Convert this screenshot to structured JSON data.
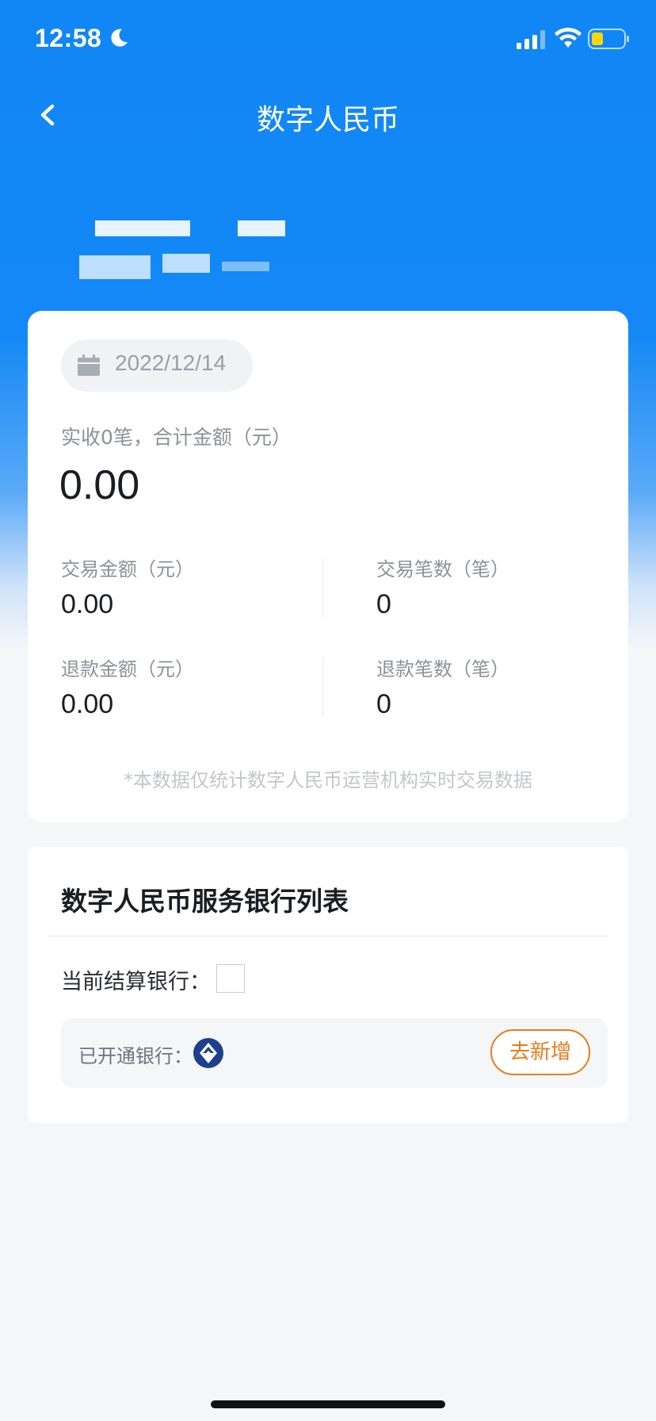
{
  "status_bar": {
    "time": "12:58",
    "icons": [
      "moon-icon",
      "signal-icon",
      "wifi-icon",
      "battery-icon"
    ]
  },
  "nav": {
    "title": "数字人民币",
    "back_icon": "chevron-left-icon"
  },
  "summary_card": {
    "date": "2022/12/14",
    "summary_label": "实收0笔，合计金额（元）",
    "summary_amount": "0.00",
    "stats": [
      {
        "label": "交易金额（元）",
        "value": "0.00"
      },
      {
        "label": "交易笔数（笔）",
        "value": "0"
      },
      {
        "label": "退款金额（元）",
        "value": "0.00"
      },
      {
        "label": "退款笔数（笔）",
        "value": "0"
      }
    ],
    "disclaimer": "*本数据仅统计数字人民币运营机构实时交易数据"
  },
  "bank_section": {
    "title": "数字人民币服务银行列表",
    "current_bank_label": "当前结算银行：",
    "opened_label": "已开通银行：",
    "add_button": "去新增"
  },
  "colors": {
    "primary_blue": "#1186f5",
    "accent_orange": "#e87d1e",
    "text_dark": "#1b1d22",
    "text_gray": "#8e9198"
  }
}
